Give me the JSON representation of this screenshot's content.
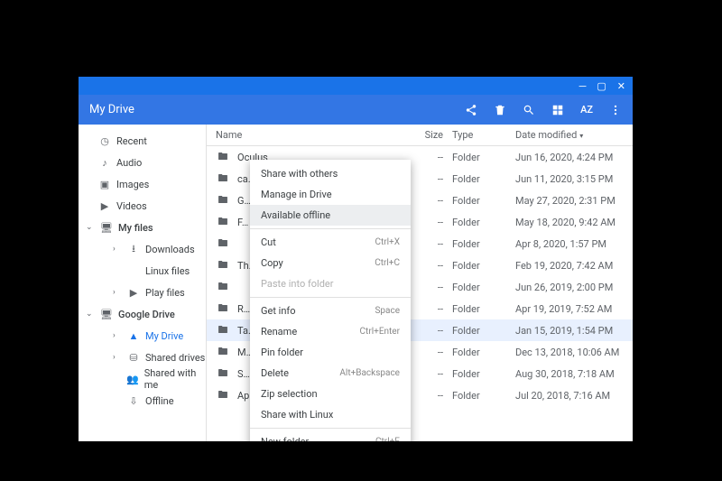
{
  "window": {
    "title": "My Drive"
  },
  "toolbar": {
    "share_icon": "share",
    "delete_icon": "delete",
    "search_icon": "search",
    "view_icon": "grid",
    "sort_label": "AZ",
    "more_icon": "more"
  },
  "columns": {
    "name": "Name",
    "size": "Size",
    "type": "Type",
    "date": "Date modified"
  },
  "sidebar": {
    "quick": [
      {
        "icon": "clock",
        "label": "Recent"
      },
      {
        "icon": "audio",
        "label": "Audio"
      },
      {
        "icon": "image",
        "label": "Images"
      },
      {
        "icon": "video",
        "label": "Videos"
      }
    ],
    "sections": [
      {
        "label": "My files",
        "expanded": true,
        "children": [
          {
            "icon": "download",
            "label": "Downloads",
            "expandable": true
          },
          {
            "icon": "linux",
            "label": "Linux files"
          },
          {
            "icon": "play",
            "label": "Play files",
            "expandable": true
          }
        ]
      },
      {
        "label": "Google Drive",
        "expanded": true,
        "children": [
          {
            "icon": "drive",
            "label": "My Drive",
            "active": true,
            "expandable": true
          },
          {
            "icon": "shared-drives",
            "label": "Shared drives",
            "expandable": true
          },
          {
            "icon": "shared",
            "label": "Shared with me"
          },
          {
            "icon": "offline",
            "label": "Offline"
          }
        ]
      }
    ]
  },
  "files": [
    {
      "name": "Oculus",
      "size": "--",
      "type": "Folder",
      "date": "Jun 16, 2020, 4:24 PM",
      "selected": false
    },
    {
      "name": "ca…",
      "size": "--",
      "type": "Folder",
      "date": "Jun 11, 2020, 3:15 PM",
      "selected": false
    },
    {
      "name": "G…",
      "size": "--",
      "type": "Folder",
      "date": "May 27, 2020, 2:31 PM",
      "selected": false
    },
    {
      "name": "F…",
      "size": "--",
      "type": "Folder",
      "date": "May 18, 2020, 9:42 AM",
      "selected": false
    },
    {
      "name": "",
      "size": "--",
      "type": "Folder",
      "date": "Apr 8, 2020, 1:57 PM",
      "selected": false
    },
    {
      "name": "Th…",
      "size": "--",
      "type": "Folder",
      "date": "Feb 19, 2020, 7:42 AM",
      "selected": false
    },
    {
      "name": "",
      "size": "--",
      "type": "Folder",
      "date": "Jun 26, 2019, 2:00 PM",
      "selected": false
    },
    {
      "name": "R…",
      "size": "--",
      "type": "Folder",
      "date": "Apr 19, 2019, 7:52 AM",
      "selected": false
    },
    {
      "name": "Ta…",
      "size": "--",
      "type": "Folder",
      "date": "Jan 15, 2019, 1:54 PM",
      "selected": true
    },
    {
      "name": "M…",
      "size": "--",
      "type": "Folder",
      "date": "Dec 13, 2018, 10:06 AM",
      "selected": false
    },
    {
      "name": "S…",
      "size": "--",
      "type": "Folder",
      "date": "Aug 30, 2018, 7:18 AM",
      "selected": false
    },
    {
      "name": "Ap…",
      "size": "--",
      "type": "Folder",
      "date": "Jul 20, 2018, 7:16 AM",
      "selected": false
    }
  ],
  "context_menu": {
    "items": [
      {
        "label": "Share with others"
      },
      {
        "label": "Manage in Drive"
      },
      {
        "label": "Available offline",
        "highlight": true
      },
      {
        "sep": true
      },
      {
        "label": "Cut",
        "shortcut": "Ctrl+X"
      },
      {
        "label": "Copy",
        "shortcut": "Ctrl+C"
      },
      {
        "label": "Paste into folder",
        "disabled": true
      },
      {
        "sep": true
      },
      {
        "label": "Get info",
        "shortcut": "Space"
      },
      {
        "label": "Rename",
        "shortcut": "Ctrl+Enter"
      },
      {
        "label": "Pin folder"
      },
      {
        "label": "Delete",
        "shortcut": "Alt+Backspace"
      },
      {
        "label": "Zip selection"
      },
      {
        "label": "Share with Linux"
      },
      {
        "sep": true
      },
      {
        "label": "New folder",
        "shortcut": "Ctrl+E"
      }
    ]
  },
  "icons": {
    "clock": "◷",
    "audio": "♪",
    "image": "▣",
    "video": "▶",
    "computer": "🖥",
    "download": "⭳",
    "linux": "</>",
    "play": "▶",
    "drive": "▲",
    "shared-drives": "⛁",
    "shared": "👥",
    "offline": "⇩",
    "folder": "🖿"
  }
}
